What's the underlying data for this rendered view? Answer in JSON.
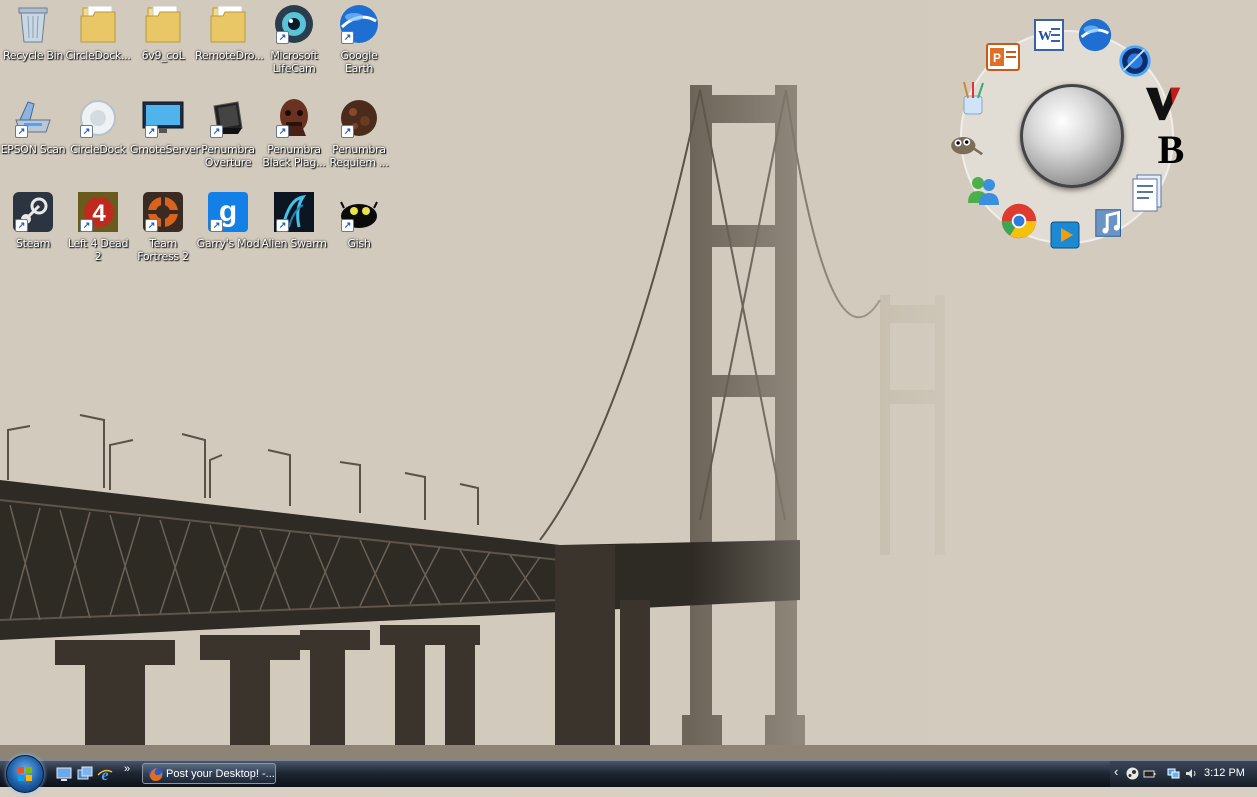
{
  "desktop": {
    "icons": [
      {
        "name": "recycle-bin",
        "label": "Recycle Bin",
        "icon": "recycle-bin-icon"
      },
      {
        "name": "circledock-folder",
        "label": "CircleDock...",
        "icon": "folder-icon"
      },
      {
        "name": "6v9-col-folder",
        "label": "6v9_coL",
        "icon": "folder-icon"
      },
      {
        "name": "remotedroid-folder",
        "label": "RemoteDro...",
        "icon": "folder-icon"
      },
      {
        "name": "microsoft-lifecam",
        "label": "Microsoft LifeCam",
        "icon": "webcam-icon"
      },
      {
        "name": "google-earth",
        "label": "Google Earth",
        "icon": "globe-icon"
      },
      {
        "name": "epson-scan",
        "label": "EPSON Scan",
        "icon": "scanner-icon"
      },
      {
        "name": "circledock",
        "label": "CircleDock",
        "icon": "circle-dock-icon"
      },
      {
        "name": "gmoteserver",
        "label": "GmoteServer",
        "icon": "monitor-icon"
      },
      {
        "name": "penumbra-overture",
        "label": "Penumbra Overture",
        "icon": "notebook-icon"
      },
      {
        "name": "penumbra-black-plague",
        "label": "Penumbra Black Plag...",
        "icon": "monster-face-icon"
      },
      {
        "name": "penumbra-requiem",
        "label": "Penumbra Requiem ...",
        "icon": "rusty-orb-icon"
      },
      {
        "name": "steam",
        "label": "Steam",
        "icon": "steam-icon"
      },
      {
        "name": "left-4-dead-2",
        "label": "Left 4 Dead 2",
        "icon": "l4d2-icon"
      },
      {
        "name": "team-fortress-2",
        "label": "Team Fortress 2",
        "icon": "tf2-icon"
      },
      {
        "name": "garrys-mod",
        "label": "Garry's Mod",
        "icon": "gmod-icon"
      },
      {
        "name": "alien-swarm",
        "label": "Alien Swarm",
        "icon": "alien-swarm-icon"
      },
      {
        "name": "gish",
        "label": "Gish",
        "icon": "gish-icon"
      }
    ]
  },
  "dock": {
    "items": [
      {
        "name": "dock-powerpoint",
        "icon": "powerpoint-icon"
      },
      {
        "name": "dock-word",
        "icon": "word-icon"
      },
      {
        "name": "dock-google-earth",
        "icon": "globe-icon"
      },
      {
        "name": "dock-browser-orb",
        "icon": "blue-orb-icon"
      },
      {
        "name": "dock-v-logo",
        "icon": "v-logo-icon"
      },
      {
        "name": "dock-b-logo",
        "icon": "b-logo-icon"
      },
      {
        "name": "dock-paint",
        "icon": "paint-brushes-icon"
      },
      {
        "name": "dock-gimp",
        "icon": "gimp-icon"
      },
      {
        "name": "dock-messenger",
        "icon": "messenger-icon"
      },
      {
        "name": "dock-chrome",
        "icon": "chrome-icon"
      },
      {
        "name": "dock-media-center",
        "icon": "media-play-icon"
      },
      {
        "name": "dock-music",
        "icon": "music-icon"
      },
      {
        "name": "dock-documents",
        "icon": "documents-icon"
      }
    ],
    "center_icon": "silver-orb-icon"
  },
  "taskbar": {
    "start_icon": "windows-logo-icon",
    "quick_launch": [
      "show-desktop-icon",
      "switch-windows-icon",
      "internet-explorer-icon"
    ],
    "more": "»",
    "tasks": [
      {
        "label": "Post your Desktop! -...",
        "icon": "firefox-icon"
      }
    ],
    "tray": {
      "chevron": "‹",
      "icons": [
        "steam-tray-icon",
        "battery-icon",
        "network-icon",
        "volume-icon"
      ],
      "clock": "3:12 PM"
    }
  },
  "colors": {
    "taskbar": "#1f2733",
    "wallpaper_sepia": "#cfc7b8",
    "bridge_dark": "#2e2a24"
  }
}
